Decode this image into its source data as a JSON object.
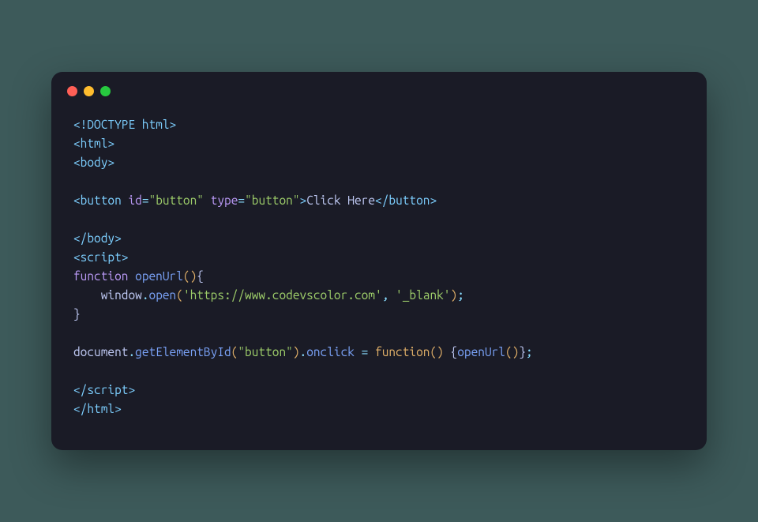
{
  "window": {
    "dots": [
      "red",
      "yellow",
      "green"
    ]
  },
  "code": {
    "l1": {
      "doctype": "<!DOCTYPE html>"
    },
    "l2": {
      "open_html": "<html>"
    },
    "l3": {
      "open_body": "<body>"
    },
    "l5": {
      "open": "<button",
      "sp1": " ",
      "id_attr": "id",
      "eq1": "=",
      "id_val": "\"button\"",
      "sp2": " ",
      "type_attr": "type",
      "eq2": "=",
      "type_val": "\"button\"",
      "close_open": ">",
      "text": "Click Here",
      "close": "</button>"
    },
    "l7": {
      "close_body": "</body>"
    },
    "l8": {
      "open_script": "<script>"
    },
    "l9": {
      "kw": "function",
      "sp": " ",
      "name": "openUrl",
      "parens": "()",
      "brace": "{"
    },
    "l10": {
      "indent": "    ",
      "window": "window",
      "dot": ".",
      "open": "open",
      "lp": "(",
      "url": "'https://www.codevscolor.com'",
      "comma": ",",
      "sp": " ",
      "blank": "'_blank'",
      "rp": ")",
      "semi": ";"
    },
    "l11": {
      "brace": "}"
    },
    "l13": {
      "document": "document",
      "dot1": ".",
      "getById": "getElementById",
      "lp1": "(",
      "arg": "\"button\"",
      "rp1": ")",
      "dot2": ".",
      "onclick": "onclick",
      "sp1": " ",
      "eq": "=",
      "sp2": " ",
      "kw": "function",
      "lp2": "(",
      "rp2": ")",
      "sp3": " ",
      "lb": "{",
      "call": "openUrl",
      "lp3": "(",
      "rp3": ")",
      "rb": "}",
      "semi": ";"
    },
    "l15": {
      "close_script": "</scr"
    },
    "l15b": {
      "close_script2": "ipt>"
    },
    "l16": {
      "close_html": "</html>"
    }
  }
}
